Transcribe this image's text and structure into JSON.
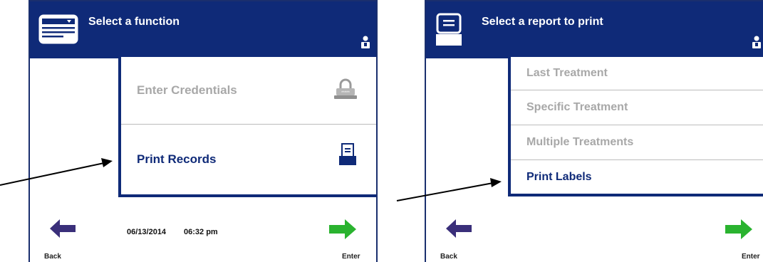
{
  "left_screen": {
    "title": "Select a function",
    "header_icon": "menu-card-icon",
    "user_icon": "user-icon",
    "menu": [
      {
        "label": "Enter Credentials",
        "state": "disabled",
        "icon": "lock-icon"
      },
      {
        "label": "Print Records",
        "state": "active",
        "icon": "printer-icon"
      }
    ],
    "footer": {
      "back_label": "Back",
      "enter_label": "Enter",
      "date": "06/13/2014",
      "time": "06:32 pm"
    }
  },
  "right_screen": {
    "title": "Select a report to print",
    "header_icon": "printer-icon",
    "user_icon": "user-icon",
    "menu": [
      {
        "label": "Last Treatment",
        "state": "disabled"
      },
      {
        "label": "Specific Treatment",
        "state": "disabled"
      },
      {
        "label": "Multiple Treatments",
        "state": "disabled"
      },
      {
        "label": "Print Labels",
        "state": "active"
      }
    ],
    "footer": {
      "back_label": "Back",
      "enter_label": "Enter"
    }
  },
  "colors": {
    "header_blue": "#0f2a78",
    "back_arrow": "#3a2f7a",
    "enter_arrow": "#2ab32f",
    "disabled_text": "#a8a8a8"
  }
}
